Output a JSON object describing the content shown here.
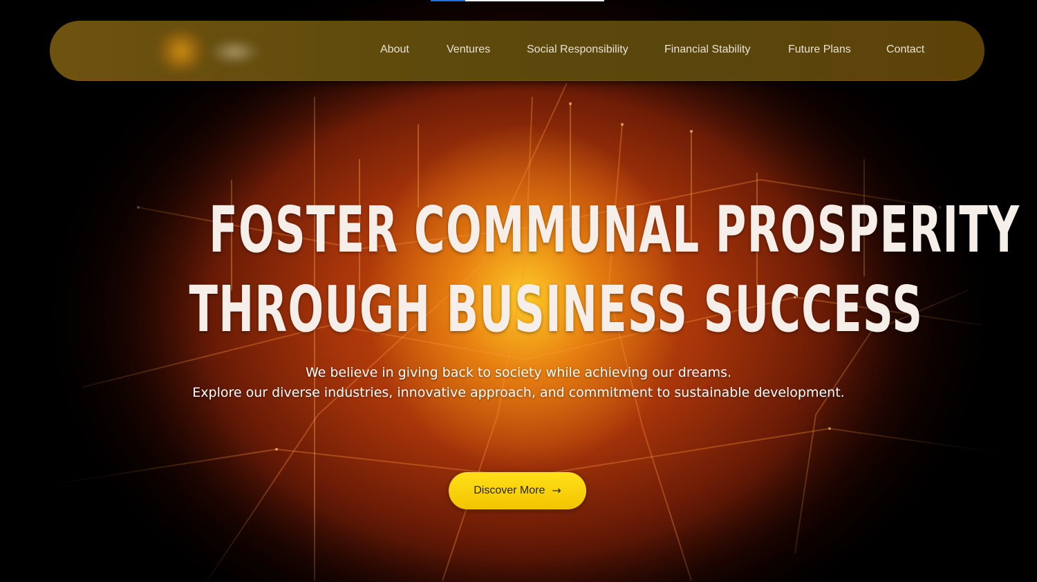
{
  "nav": {
    "items": [
      {
        "label": "About"
      },
      {
        "label": "Ventures"
      },
      {
        "label": "Social Responsibility"
      },
      {
        "label": "Financial Stability"
      },
      {
        "label": "Future Plans"
      },
      {
        "label": "Contact"
      }
    ]
  },
  "hero": {
    "headline_line1": "FOSTER COMMUNAL PROSPERITY",
    "headline_line2": "THROUGH BUSINESS SUCCESS",
    "subtext_line1": "We believe in giving back to society while achieving our dreams.",
    "subtext_line2": "Explore our diverse industries, innovative approach, and commitment to sustainable development.",
    "cta_label": "Discover More",
    "cta_icon": "arrow-right-icon"
  },
  "colors": {
    "accent": "#f5cc00",
    "nav_bg": "#5e4a0c",
    "background": "#000000"
  }
}
